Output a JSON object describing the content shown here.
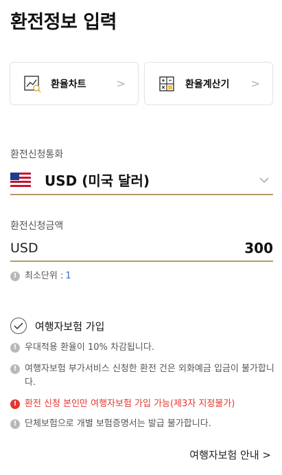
{
  "header": {
    "title": "환전정보 입력"
  },
  "shortcuts": {
    "chart_label": "환율차트",
    "calc_label": "환율계산기",
    "chevron": ">"
  },
  "currency": {
    "label": "환전신청통화",
    "selected": "USD (미국 달러)",
    "flag": "us-flag-icon"
  },
  "amount": {
    "label": "환전신청금액",
    "currency_code": "USD",
    "value": "300",
    "min_unit_label": "최소단위 :",
    "min_unit_value": "1"
  },
  "insurance": {
    "label": "여행자보험 가입",
    "notes": [
      "우대적용 환율이 10% 차감됩니다.",
      "여행자보험 부가서비스 신청한 환전 건은 외화예금 입금이 불가합니다.",
      "환전 신청 본인만 여행자보험 가입 가능(제3자 지정불가)",
      "단체보험으로 개별 보험증명서는 발급 불가합니다."
    ],
    "guide_link": "여행자보험 안내 >"
  },
  "colors": {
    "accent_underline": "#b19a66",
    "warning_text": "#e5352e",
    "link_blue": "#2f6fd6"
  }
}
